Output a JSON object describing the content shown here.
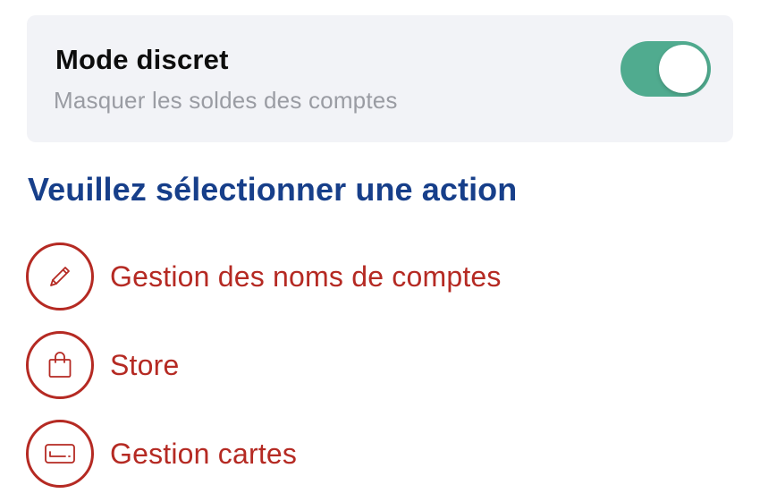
{
  "discreet_mode": {
    "title": "Mode discret",
    "subtitle": "Masquer les soldes des comptes",
    "enabled": true,
    "toggle_color": "#50ab8f"
  },
  "actions": {
    "heading": "Veuillez sélectionner une action",
    "items": [
      {
        "label": "Gestion des noms de comptes",
        "icon": "pencil-icon"
      },
      {
        "label": "Store",
        "icon": "shopping-bag-icon"
      },
      {
        "label": "Gestion cartes",
        "icon": "card-icon"
      }
    ]
  },
  "colors": {
    "heading": "#173f8a",
    "action": "#b52a23",
    "card_background": "#f2f3f7"
  }
}
